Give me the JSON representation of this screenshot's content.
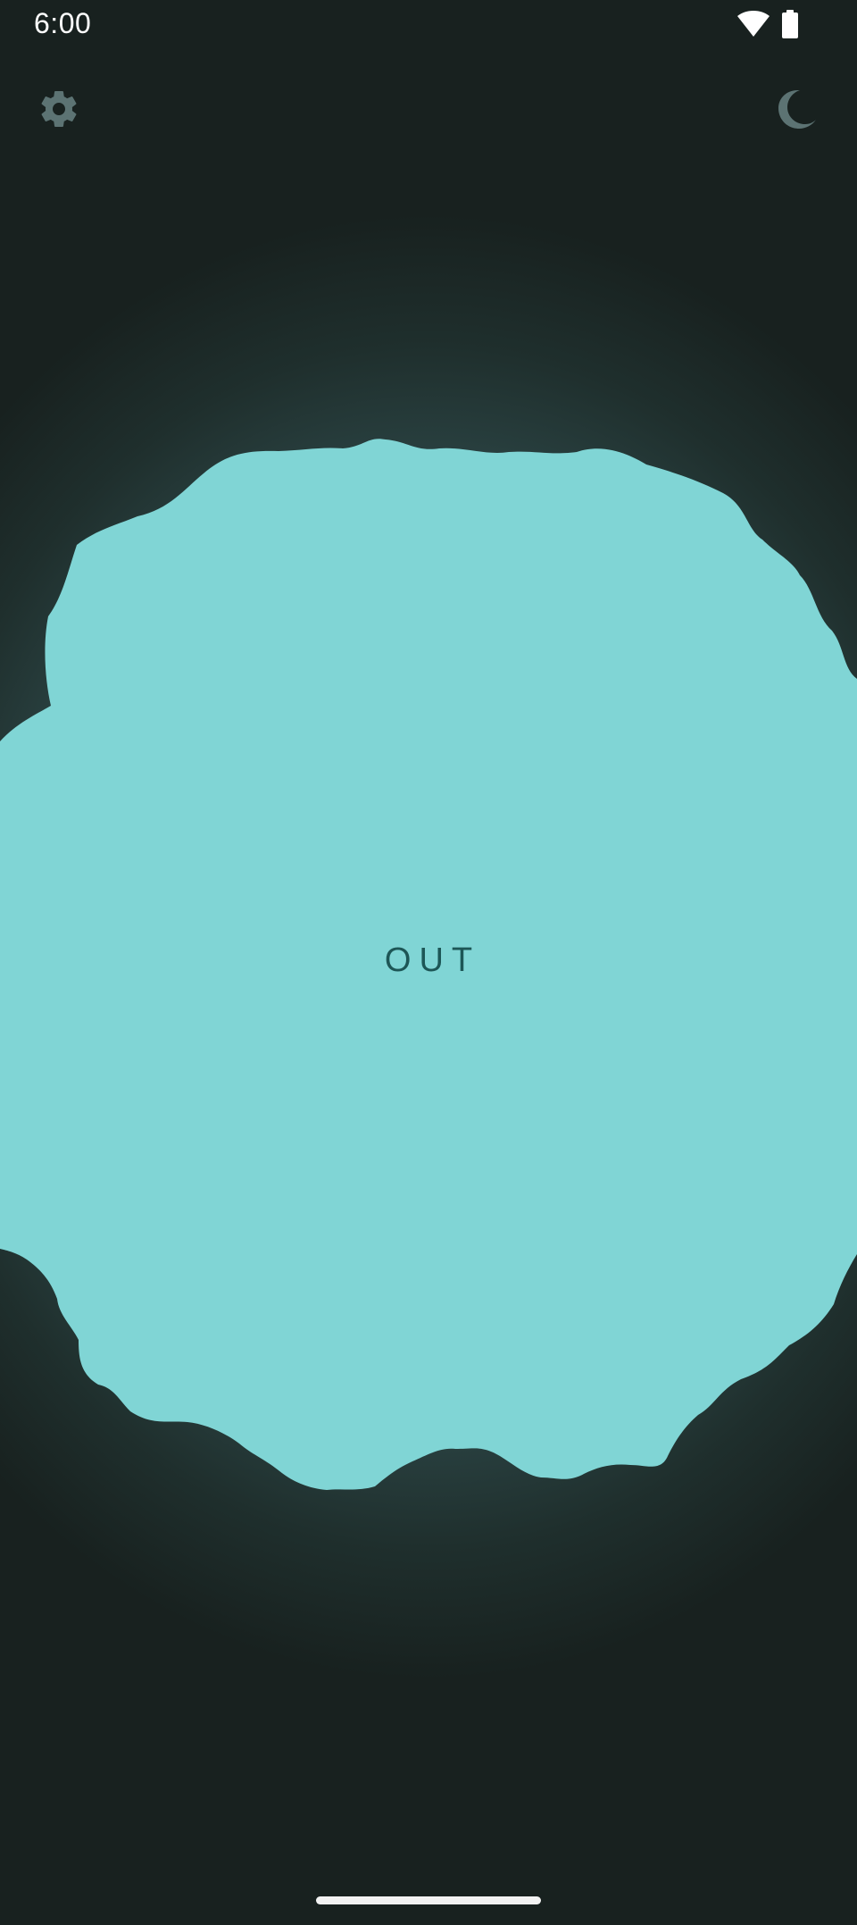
{
  "status_bar": {
    "time": "6:00",
    "wifi_icon": "wifi-icon",
    "battery_icon": "battery-icon"
  },
  "toolbar": {
    "settings_icon": "gear-icon",
    "theme_icon": "moon-icon"
  },
  "breathing": {
    "phase": "OUT"
  },
  "colors": {
    "blob": "#80d5d5",
    "phase_text": "#1d5656",
    "icon": "#5c7373",
    "background_dark": "#18211f",
    "background_glow": "#4c7474"
  }
}
